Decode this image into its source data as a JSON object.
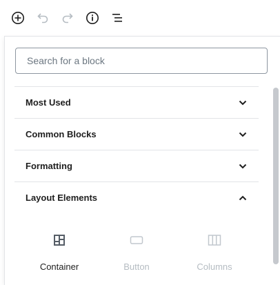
{
  "toolbar": {
    "add_icon": "plus-circle-icon",
    "undo_icon": "undo-icon",
    "redo_icon": "redo-icon",
    "info_icon": "info-icon",
    "outline_icon": "list-outline-icon"
  },
  "inserter": {
    "search_placeholder": "Search for a block",
    "sections": [
      {
        "label": "Most Used",
        "expanded": false
      },
      {
        "label": "Common Blocks",
        "expanded": false
      },
      {
        "label": "Formatting",
        "expanded": false
      },
      {
        "label": "Layout Elements",
        "expanded": true
      }
    ],
    "blocks": [
      {
        "label": "Container",
        "icon": "container-icon",
        "enabled": true
      },
      {
        "label": "Button",
        "icon": "button-icon",
        "enabled": false
      },
      {
        "label": "Columns",
        "icon": "columns-icon",
        "enabled": false
      }
    ]
  },
  "colors": {
    "text": "#1e1e1e",
    "muted": "#a2aab2",
    "border": "#e2e4e7",
    "input_border": "#8d96a0",
    "scroll_thumb": "#c6c9ce"
  }
}
